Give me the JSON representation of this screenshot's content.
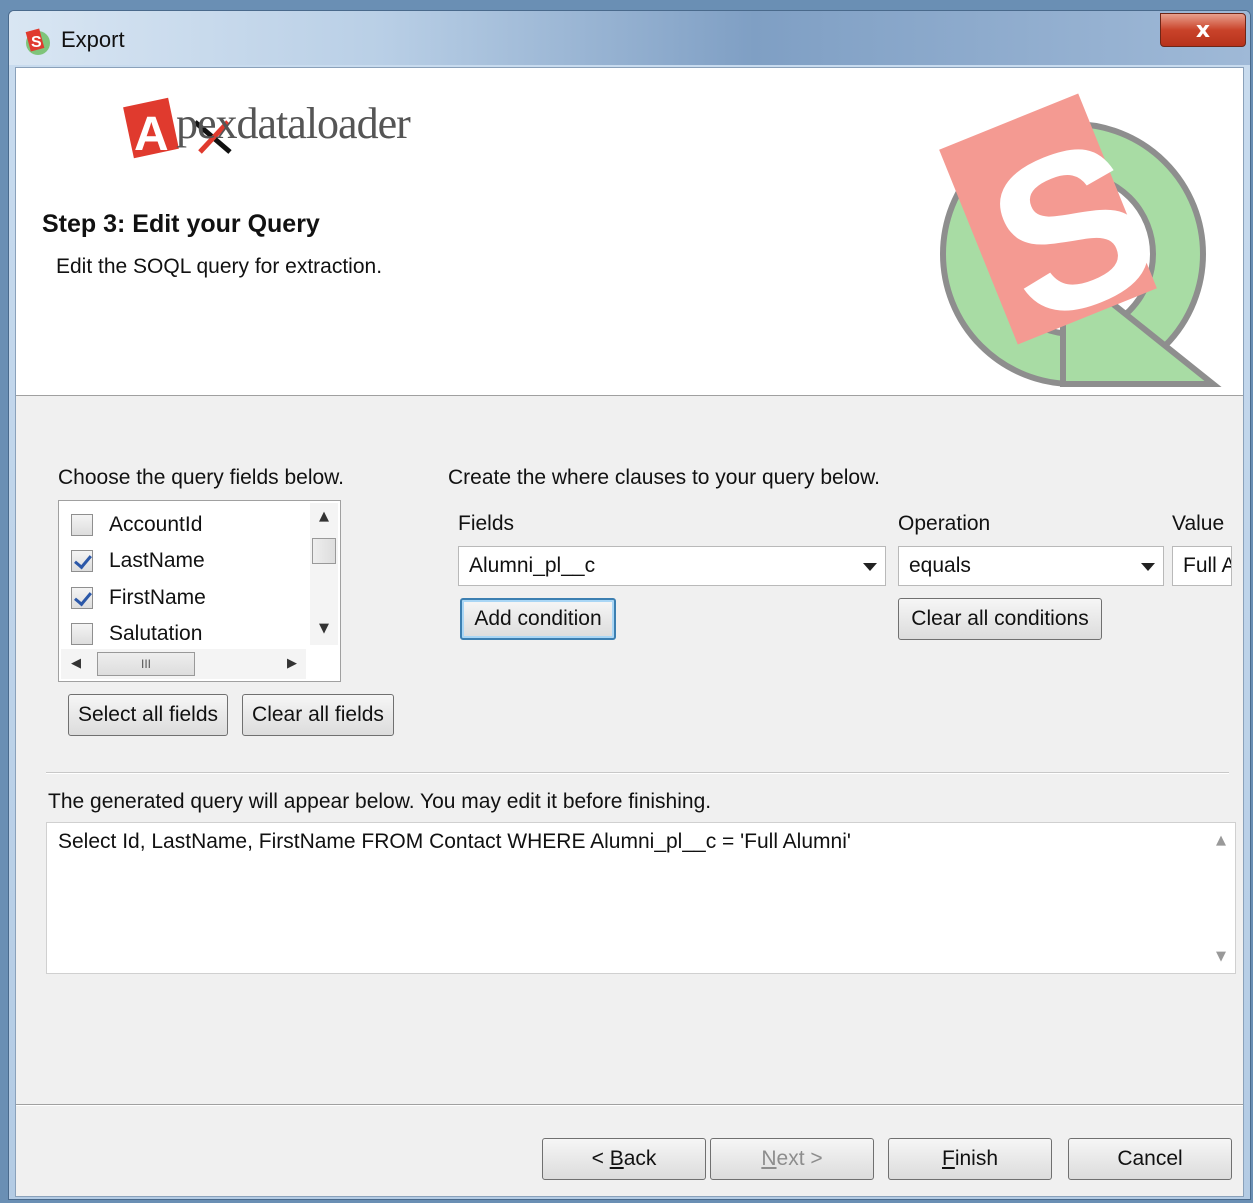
{
  "window": {
    "title": "Export",
    "close_label": "x"
  },
  "banner": {
    "brand_rest": "pexdataloader",
    "brand_letter": "A",
    "step_title": "Step 3: Edit your Query",
    "step_subtitle": "Edit the SOQL query for extraction."
  },
  "fields_panel": {
    "label": "Choose the query fields below.",
    "items": [
      {
        "name": "AccountId",
        "checked": false
      },
      {
        "name": "LastName",
        "checked": true
      },
      {
        "name": "FirstName",
        "checked": true
      },
      {
        "name": "Salutation",
        "checked": false
      }
    ],
    "hscroll_grip": "III",
    "select_all_label": "Select all fields",
    "clear_all_label": "Clear all fields"
  },
  "where_panel": {
    "label": "Create the where clauses to your query below.",
    "fields_header": "Fields",
    "operation_header": "Operation",
    "value_header": "Value",
    "field_selected": "Alumni_pl__c",
    "operation_selected": "equals",
    "value_text": "Full Alumni",
    "add_condition_label": "Add condition",
    "clear_conditions_label": "Clear all conditions"
  },
  "query": {
    "label": "The generated query will appear below.  You may edit it before finishing.",
    "text": "Select Id, LastName, FirstName FROM Contact WHERE Alumni_pl__c = 'Full Alumni'"
  },
  "footer": {
    "back_prefix": "< ",
    "back_key": "B",
    "back_rest": "ack",
    "next_key": "N",
    "next_rest": "ext >",
    "finish_key": "F",
    "finish_rest": "inish",
    "cancel_label": "Cancel"
  },
  "colors": {
    "brand_red": "#e03a2e",
    "logo_green": "#9fd59a",
    "logo_pink": "#f49a92",
    "focus_blue": "#3c7fb1"
  }
}
